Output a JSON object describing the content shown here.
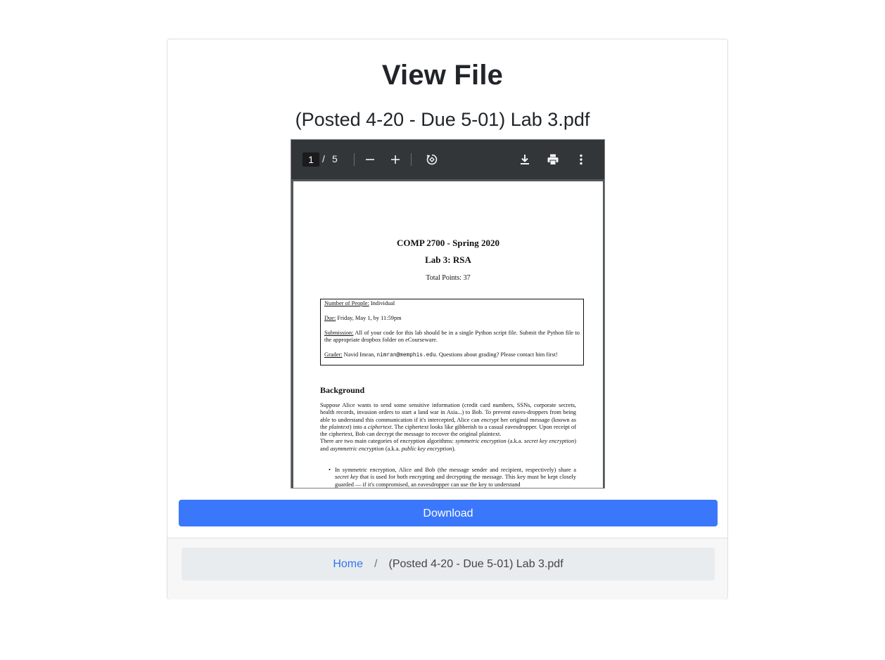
{
  "header": {
    "title": "View File",
    "file_name": "(Posted 4-20 - Due 5-01) Lab 3.pdf"
  },
  "viewer": {
    "current_page": "1",
    "page_separator": "/",
    "total_pages": "5",
    "icons": [
      "zoom-out-icon",
      "zoom-in-icon",
      "rotate-icon",
      "download-icon",
      "print-icon",
      "more-options-icon"
    ]
  },
  "document": {
    "course": "COMP 2700 - Spring 2020",
    "lab": "Lab 3: RSA",
    "points": "Total Points: 37",
    "people_label": "Number of People:",
    "people_value": " Individual",
    "due_label": "Due:",
    "due_value": " Friday, May 1, by 11:59pm",
    "submission_label": "Submission:",
    "submission_value": " All of your code for this lab should be in a single Python script file. Submit the Python file to the appropriate dropbox folder on eCourseware.",
    "grader_label": "Grader:",
    "grader_name": " Navid Imran, ",
    "grader_email": "nimran@memphis.edu",
    "grader_note": ". Questions about grading? Please contact him first!",
    "section_heading": "Background",
    "para1_a": "Suppose Alice wants to send some sensitive information (credit card numbers, SSNs, corporate secrets, health records, invasion orders to start a land war in Asia...) to Bob. To prevent eaves-droppers from being able to understand this communication if it's intercepted, Alice can ",
    "para1_encrypt": "encrypt",
    "para1_b": " her original message (known as the ",
    "para1_plaintext": "plaintext",
    "para1_c": ") into a ",
    "para1_ciphertext": "ciphertext",
    "para1_d": ". The ciphertext looks like gibberish to a casual eavesdropper. Upon receipt of the ciphertext, Bob can decrypt the message to recover the original plaintext.",
    "para2_a": "There are two main categories of encryption algorithms: ",
    "para2_sym": "symmetric encryption",
    "para2_b": " (a.k.a. ",
    "para2_secret": "secret key encryption",
    "para2_c": ") and ",
    "para2_asym": "asymmetric encryption",
    "para2_d": " (a.k.a. ",
    "para2_public": "public key encryption",
    "para2_e": ").",
    "bullet_dot": "•",
    "bullet_a": "In symmetric encryption, Alice and Bob (the message sender and recipient, respectively) share a ",
    "bullet_secret": "secret key",
    "bullet_b": " that is used for both encrypting and decrypting the message. This key must be kept closely guarded — if it's compromised, an eavesdropper can use the key to understand"
  },
  "actions": {
    "download_label": "Download"
  },
  "breadcrumb": {
    "home_label": "Home",
    "separator": "/",
    "current": "(Posted 4-20 - Due 5-01) Lab 3.pdf"
  }
}
